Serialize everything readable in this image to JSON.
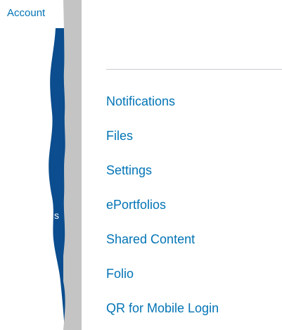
{
  "nav": {
    "account_label": "Account",
    "partial_label": "s",
    "background_color": "#0b4d8e"
  },
  "tray": {
    "scrollbar_color": "#c4c4c4",
    "link_color": "#0374b5",
    "items": [
      {
        "label": "Notifications"
      },
      {
        "label": "Files"
      },
      {
        "label": "Settings"
      },
      {
        "label": "ePortfolios"
      },
      {
        "label": "Shared Content"
      },
      {
        "label": "Folio"
      },
      {
        "label": "QR for Mobile Login"
      }
    ]
  }
}
